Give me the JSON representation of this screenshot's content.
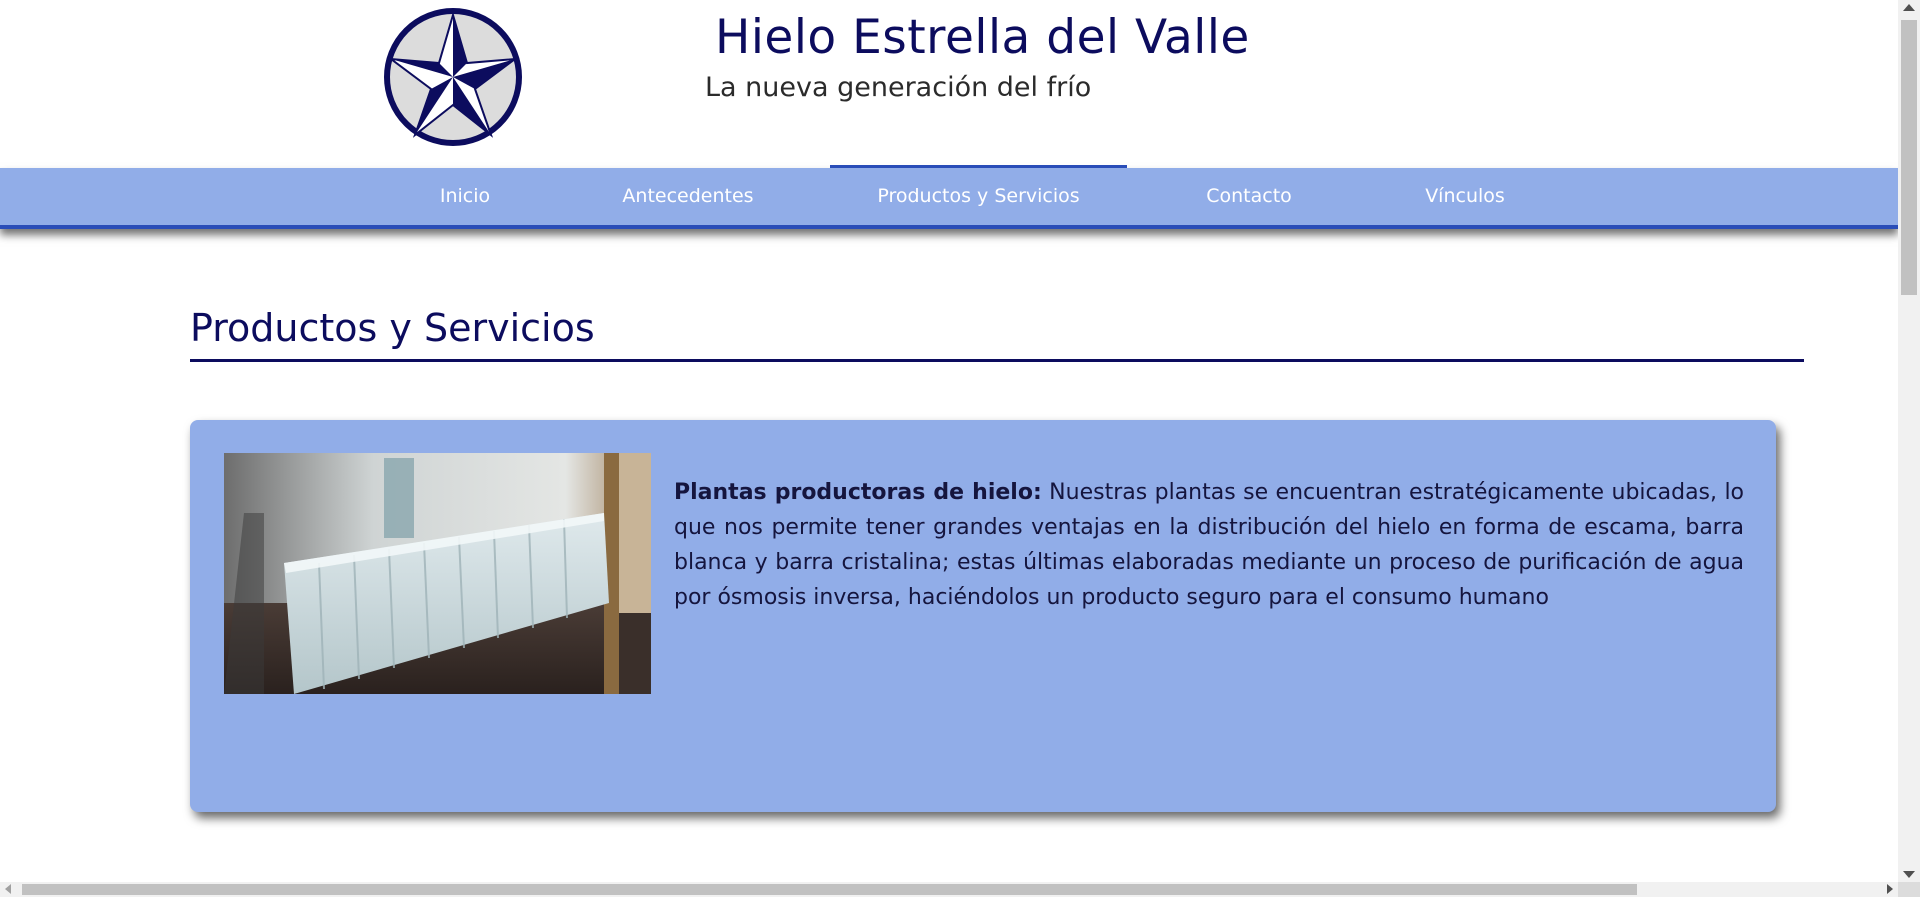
{
  "header": {
    "title": "Hielo Estrella del Valle",
    "subtitle": "La nueva generación del frío",
    "logo_icon": "star-logo-icon"
  },
  "nav": {
    "items": [
      {
        "label": "Inicio",
        "active": false
      },
      {
        "label": "Antecedentes",
        "active": false
      },
      {
        "label": "Productos y Servicios",
        "active": true
      },
      {
        "label": "Contacto",
        "active": false
      },
      {
        "label": "Vínculos",
        "active": false
      }
    ]
  },
  "main": {
    "heading": "Productos y Servicios",
    "card": {
      "lead": "Plantas productoras de hielo:",
      "body": " Nuestras plantas se encuentran estratégicamente ubicadas, lo que nos permite tener grandes ventajas en la distribución del hielo en forma de escama, barra blanca y barra cristalina; estas últimas elaboradas mediante un proceso de purificación de agua por ósmosis inversa, haciéndolos un producto seguro para el consumo humano"
    }
  },
  "colors": {
    "brand_navy": "#0c0c5e",
    "nav_bg": "#91ade8",
    "nav_accent": "#2a4db8",
    "card_bg": "#91ade8"
  }
}
